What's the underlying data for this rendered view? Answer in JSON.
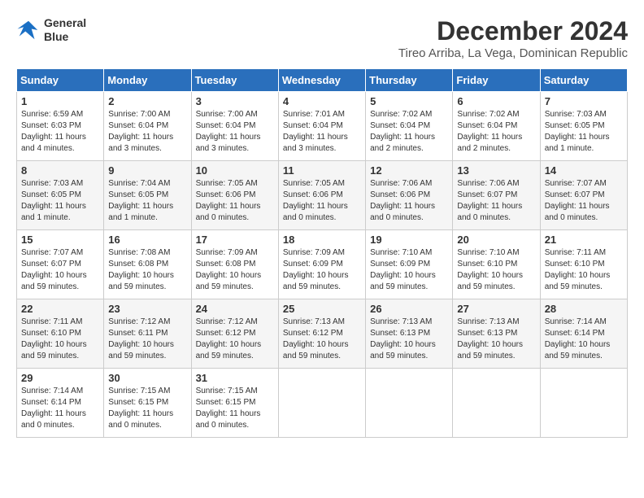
{
  "header": {
    "logo_line1": "General",
    "logo_line2": "Blue",
    "month": "December 2024",
    "location": "Tireo Arriba, La Vega, Dominican Republic"
  },
  "weekdays": [
    "Sunday",
    "Monday",
    "Tuesday",
    "Wednesday",
    "Thursday",
    "Friday",
    "Saturday"
  ],
  "weeks": [
    [
      {
        "day": "1",
        "sunrise": "6:59 AM",
        "sunset": "6:03 PM",
        "daylight": "11 hours and 4 minutes."
      },
      {
        "day": "2",
        "sunrise": "7:00 AM",
        "sunset": "6:04 PM",
        "daylight": "11 hours and 3 minutes."
      },
      {
        "day": "3",
        "sunrise": "7:00 AM",
        "sunset": "6:04 PM",
        "daylight": "11 hours and 3 minutes."
      },
      {
        "day": "4",
        "sunrise": "7:01 AM",
        "sunset": "6:04 PM",
        "daylight": "11 hours and 3 minutes."
      },
      {
        "day": "5",
        "sunrise": "7:02 AM",
        "sunset": "6:04 PM",
        "daylight": "11 hours and 2 minutes."
      },
      {
        "day": "6",
        "sunrise": "7:02 AM",
        "sunset": "6:04 PM",
        "daylight": "11 hours and 2 minutes."
      },
      {
        "day": "7",
        "sunrise": "7:03 AM",
        "sunset": "6:05 PM",
        "daylight": "11 hours and 1 minute."
      }
    ],
    [
      {
        "day": "8",
        "sunrise": "7:03 AM",
        "sunset": "6:05 PM",
        "daylight": "11 hours and 1 minute."
      },
      {
        "day": "9",
        "sunrise": "7:04 AM",
        "sunset": "6:05 PM",
        "daylight": "11 hours and 1 minute."
      },
      {
        "day": "10",
        "sunrise": "7:05 AM",
        "sunset": "6:06 PM",
        "daylight": "11 hours and 0 minutes."
      },
      {
        "day": "11",
        "sunrise": "7:05 AM",
        "sunset": "6:06 PM",
        "daylight": "11 hours and 0 minutes."
      },
      {
        "day": "12",
        "sunrise": "7:06 AM",
        "sunset": "6:06 PM",
        "daylight": "11 hours and 0 minutes."
      },
      {
        "day": "13",
        "sunrise": "7:06 AM",
        "sunset": "6:07 PM",
        "daylight": "11 hours and 0 minutes."
      },
      {
        "day": "14",
        "sunrise": "7:07 AM",
        "sunset": "6:07 PM",
        "daylight": "11 hours and 0 minutes."
      }
    ],
    [
      {
        "day": "15",
        "sunrise": "7:07 AM",
        "sunset": "6:07 PM",
        "daylight": "10 hours and 59 minutes."
      },
      {
        "day": "16",
        "sunrise": "7:08 AM",
        "sunset": "6:08 PM",
        "daylight": "10 hours and 59 minutes."
      },
      {
        "day": "17",
        "sunrise": "7:09 AM",
        "sunset": "6:08 PM",
        "daylight": "10 hours and 59 minutes."
      },
      {
        "day": "18",
        "sunrise": "7:09 AM",
        "sunset": "6:09 PM",
        "daylight": "10 hours and 59 minutes."
      },
      {
        "day": "19",
        "sunrise": "7:10 AM",
        "sunset": "6:09 PM",
        "daylight": "10 hours and 59 minutes."
      },
      {
        "day": "20",
        "sunrise": "7:10 AM",
        "sunset": "6:10 PM",
        "daylight": "10 hours and 59 minutes."
      },
      {
        "day": "21",
        "sunrise": "7:11 AM",
        "sunset": "6:10 PM",
        "daylight": "10 hours and 59 minutes."
      }
    ],
    [
      {
        "day": "22",
        "sunrise": "7:11 AM",
        "sunset": "6:10 PM",
        "daylight": "10 hours and 59 minutes."
      },
      {
        "day": "23",
        "sunrise": "7:12 AM",
        "sunset": "6:11 PM",
        "daylight": "10 hours and 59 minutes."
      },
      {
        "day": "24",
        "sunrise": "7:12 AM",
        "sunset": "6:12 PM",
        "daylight": "10 hours and 59 minutes."
      },
      {
        "day": "25",
        "sunrise": "7:13 AM",
        "sunset": "6:12 PM",
        "daylight": "10 hours and 59 minutes."
      },
      {
        "day": "26",
        "sunrise": "7:13 AM",
        "sunset": "6:13 PM",
        "daylight": "10 hours and 59 minutes."
      },
      {
        "day": "27",
        "sunrise": "7:13 AM",
        "sunset": "6:13 PM",
        "daylight": "10 hours and 59 minutes."
      },
      {
        "day": "28",
        "sunrise": "7:14 AM",
        "sunset": "6:14 PM",
        "daylight": "10 hours and 59 minutes."
      }
    ],
    [
      {
        "day": "29",
        "sunrise": "7:14 AM",
        "sunset": "6:14 PM",
        "daylight": "11 hours and 0 minutes."
      },
      {
        "day": "30",
        "sunrise": "7:15 AM",
        "sunset": "6:15 PM",
        "daylight": "11 hours and 0 minutes."
      },
      {
        "day": "31",
        "sunrise": "7:15 AM",
        "sunset": "6:15 PM",
        "daylight": "11 hours and 0 minutes."
      },
      null,
      null,
      null,
      null
    ]
  ]
}
